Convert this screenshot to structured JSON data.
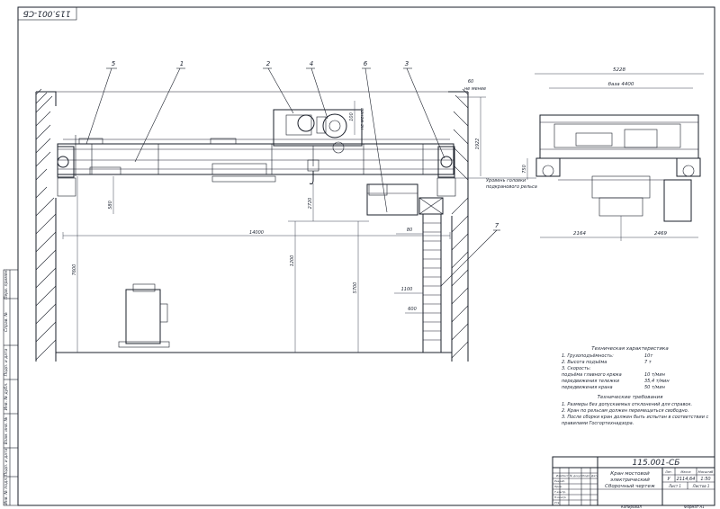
{
  "drawing_number_rotated": "115.001-СБ",
  "main_view": {
    "callouts": [
      "1",
      "2",
      "3",
      "4",
      "5",
      "6",
      "7"
    ],
    "dimensions": {
      "d60": "60",
      "ne_menee_top": "не менее",
      "d100": "100",
      "ne_menee_side": "не менее",
      "d1922": "1922",
      "d580": "580",
      "d2720": "2720",
      "d14000": "14000",
      "d80": "80",
      "d7600": "7600",
      "d1200": "1200",
      "d5700": "5700",
      "d1100": "1100",
      "d600": "600"
    },
    "rail_level_label_1": "Уровень головки",
    "rail_level_label_2": "подкранового рельса"
  },
  "side_view": {
    "dimensions": {
      "d5228": "5228",
      "base": "база 4400",
      "d750": "750",
      "d2164": "2164",
      "d2469": "2469"
    }
  },
  "specs": {
    "title": "Техническая характеристика",
    "lines": [
      {
        "label": "1. Грузоподъёмность:",
        "value": "10т"
      },
      {
        "label": "2. Высота подъёма",
        "value": "7 т"
      },
      {
        "label": "3. Скорость:",
        "value": ""
      },
      {
        "label": "подъёма главного крюка",
        "value": "10 т/мин"
      },
      {
        "label": "передвижения тележки",
        "value": "35,4 т/мин"
      },
      {
        "label": "передвижения крана",
        "value": "50 т/мин"
      }
    ]
  },
  "requirements": {
    "title": "Технические требования",
    "lines": [
      "1. Размеры без допускаемых отклонений для справок.",
      "2. Кран по рельсам должен перемещаться свободно.",
      "3. После сборки кран должен быть испытан в соответствии с",
      "правилами Госгортехнадзора."
    ]
  },
  "title_block": {
    "doc_number": "115.001-СБ",
    "name_1": "Кран мостовой",
    "name_2": "электрический",
    "name_3": "Сборочный чертеж",
    "lit": "Лит.",
    "mass": "Масса",
    "scale": "Масштаб",
    "lit_value": "У",
    "mass_value": "2114,64",
    "scale_value": "1:50",
    "sheet": "Лист 1",
    "sheets": "Листов 1",
    "col_izm": "Изм",
    "col_list": "Лист",
    "col_ndoc": "№ докум.",
    "col_podp": "Подп.",
    "col_data": "Дата",
    "row_razrab": "Разраб.",
    "row_prov": "Пров.",
    "row_tkontr": "Т.контр.",
    "row_nkontr": "Н.контр.",
    "row_utv": "Утв.",
    "kopiroval": "Копировал",
    "format": "Формат   А1"
  },
  "side_strip": {
    "labels": [
      "Перв. примен.",
      "Справ. №",
      "Подп. и дата",
      "Инв. № дубл.",
      "Взам. инв. №",
      "Подп. и дата",
      "Инв. № подл."
    ]
  }
}
